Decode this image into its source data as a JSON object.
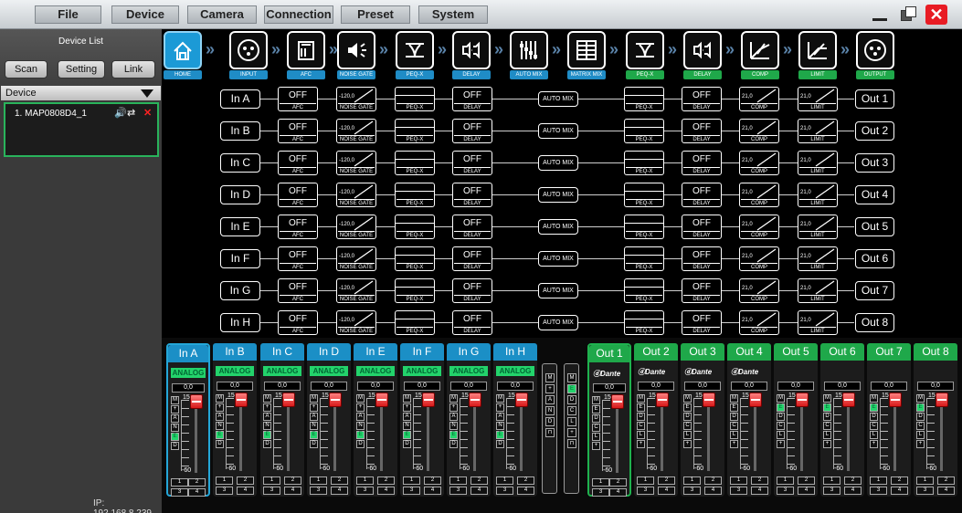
{
  "menu": [
    "File",
    "Device",
    "Camera",
    "Connection",
    "Preset",
    "System"
  ],
  "window_controls": {
    "minimize": "minimize",
    "maximize": "maximize",
    "close": "✕"
  },
  "sidebar": {
    "title": "Device List",
    "buttons": [
      "Scan",
      "Setting",
      "Link"
    ],
    "device_header": "Device",
    "devices": [
      {
        "name": "1. MAP0808D4_1",
        "icons": [
          "speaker-icon",
          "loop-icon",
          "delete-icon"
        ]
      }
    ],
    "ip": "IP: 192.168.8.239"
  },
  "toolbar": [
    {
      "label": "HOME",
      "icon": "home-icon",
      "color": "blue",
      "active": true
    },
    {
      "label": "INPUT",
      "icon": "xlr-input-icon",
      "color": "blue"
    },
    {
      "label": "AFC",
      "icon": "afc-icon",
      "color": "blue"
    },
    {
      "label": "NOISE GATE",
      "icon": "noise-gate-icon",
      "color": "blue"
    },
    {
      "label": "PEQ-X",
      "icon": "peq-icon",
      "color": "blue"
    },
    {
      "label": "DELAY",
      "icon": "delay-icon",
      "color": "blue"
    },
    {
      "label": "AUTO MIX",
      "icon": "auto-mix-icon",
      "color": "blue"
    },
    {
      "label": "MATRIX MIX",
      "icon": "matrix-mix-icon",
      "color": "blue"
    },
    {
      "label": "PEQ-X",
      "icon": "peq-icon",
      "color": "green"
    },
    {
      "label": "DELAY",
      "icon": "delay-icon",
      "color": "green"
    },
    {
      "label": "COMP",
      "icon": "compressor-icon",
      "color": "green"
    },
    {
      "label": "LIMIT",
      "icon": "limiter-icon",
      "color": "green"
    },
    {
      "label": "OUTPUT",
      "icon": "xlr-output-icon",
      "color": "green"
    }
  ],
  "matrix": {
    "inputs": [
      "In A",
      "In B",
      "In C",
      "In D",
      "In E",
      "In F",
      "In G",
      "In H"
    ],
    "outputs": [
      "Out 1",
      "Out 2",
      "Out 3",
      "Out 4",
      "Out 5",
      "Out 6",
      "Out 7",
      "Out 8"
    ],
    "afc": {
      "value": "OFF",
      "label": "AFC"
    },
    "noise_gate": {
      "value": "-120,0",
      "label": "NOISE GATE"
    },
    "peq_label": "PEQ-X",
    "delay": {
      "value": "OFF",
      "label": "DELAY"
    },
    "auto_mix": "AUTO MIX",
    "comp": {
      "value": "21,0",
      "label": "COMP"
    },
    "limit": {
      "value": "21,0",
      "label": "LIMIT"
    }
  },
  "input_strips": {
    "names": [
      "In A",
      "In B",
      "In C",
      "In D",
      "In E",
      "In F",
      "In G",
      "In H"
    ],
    "source": "ANALOG",
    "gain": "0,0",
    "buttons": [
      "M",
      "+",
      "A",
      "N",
      "E",
      "D"
    ],
    "scale_top": "15",
    "scale_bottom": "-60",
    "channels": [
      "1",
      "2",
      "3",
      "4"
    ]
  },
  "mix_columns": [
    [
      "M",
      "+",
      "A",
      "N",
      "D",
      "⊓"
    ],
    [
      "M",
      "E",
      "D",
      "C",
      "L",
      "+",
      "⊓"
    ]
  ],
  "output_strips": {
    "names": [
      "Out 1",
      "Out 2",
      "Out 3",
      "Out 4",
      "Out 5",
      "Out 6",
      "Out 7",
      "Out 8"
    ],
    "dante_label": "Dante",
    "dante_count": 4,
    "gain": "0,0",
    "buttons": [
      "M",
      "E",
      "D",
      "C",
      "L",
      "+"
    ],
    "scale_top": "15",
    "scale_bottom": "-60",
    "channels": [
      "1",
      "2",
      "3",
      "4"
    ]
  },
  "colors": {
    "input_accent": "#1b8fc6",
    "output_accent": "#1fa84a",
    "active_button": "#23d36b",
    "fader_knob": "#e01f1f"
  }
}
